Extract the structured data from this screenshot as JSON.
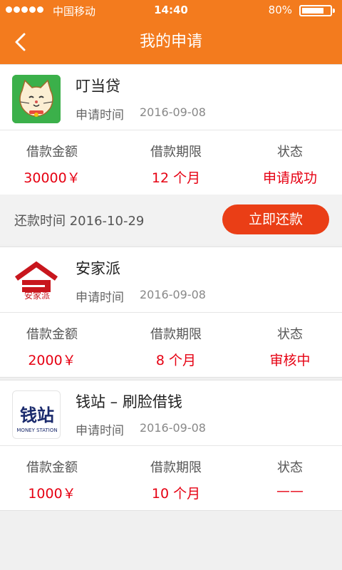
{
  "status_bar": {
    "carrier": "中国移动",
    "time": "14:40",
    "battery": "80%",
    "battery_level": 0.8
  },
  "nav": {
    "title": "我的申请",
    "back_icon": "chevron-left-icon"
  },
  "colors": {
    "brand": "#f37b1e",
    "accent_red": "#e60012",
    "button": "#ea3e16"
  },
  "labels": {
    "apply_time": "申请时间",
    "amount": "借款金额",
    "term": "借款期限",
    "status": "状态"
  },
  "applications": [
    {
      "name": "叮当贷",
      "date": "2016-09-08",
      "amount": "30000￥",
      "term": "12 个月",
      "status": "申请成功"
    },
    {
      "name": "安家派",
      "date": "2016-09-08",
      "amount": "2000￥",
      "term": "8 个月",
      "status": "审核中"
    },
    {
      "name": "钱站 – 刷脸借钱",
      "date": "2016-09-08",
      "amount": "1000￥",
      "term": "10 个月",
      "status": "——"
    }
  ],
  "repayment": {
    "label": "还款时间",
    "date": "2016-10-29",
    "button": "立即还款"
  },
  "logos": {
    "anjiapai_text": "安家派",
    "qianzhan_text": "钱站",
    "qianzhan_sub": "MONEY STATION"
  }
}
